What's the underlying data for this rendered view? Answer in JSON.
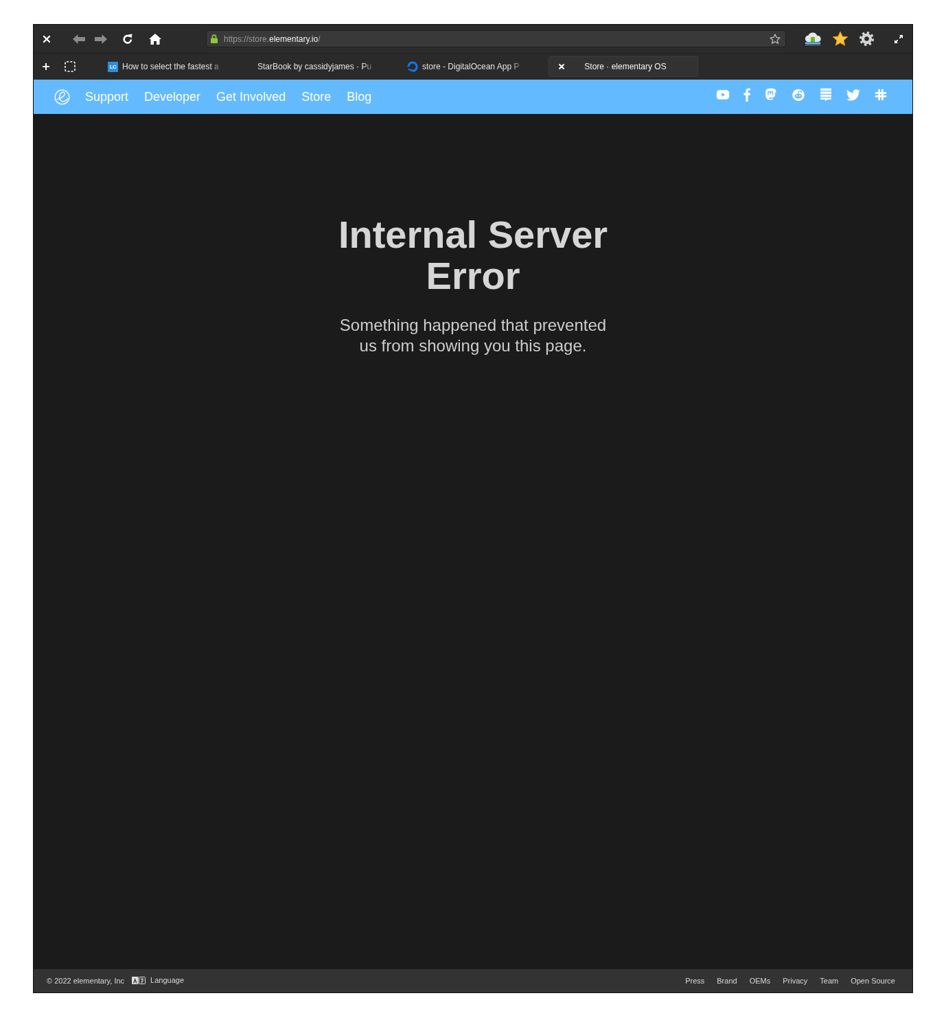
{
  "toolbar": {
    "navigation": [
      {
        "kind": "back",
        "disabled": true
      },
      {
        "kind": "forward",
        "disabled": true
      },
      {
        "kind": "reload",
        "disabled": false
      },
      {
        "kind": "home",
        "disabled": false
      }
    ],
    "address": {
      "host_prefix": "https://store.",
      "domain": "elementary.io",
      "path": "/"
    }
  },
  "tabs": [
    {
      "label": "How to select the fastest a",
      "kind": "badge",
      "badge": "LC",
      "selected": false
    },
    {
      "label": "StarBook by cassidyjames · Pu",
      "kind": "plain",
      "selected": false
    },
    {
      "label": "store - DigitalOcean App P",
      "kind": "ring",
      "selected": false
    },
    {
      "label": "Store · elementary OS",
      "kind": "plain",
      "selected": true
    }
  ],
  "nav": {
    "links": [
      "Support",
      "Developer",
      "Get Involved",
      "Store",
      "Blog"
    ]
  },
  "error": {
    "title": "Internal Server Error",
    "message": "Something happened that prevented us from showing you this page."
  },
  "footer": {
    "copyright": "© 2022 elementary, Inc",
    "language": "Language",
    "links": [
      "Press",
      "Brand",
      "OEMs",
      "Privacy",
      "Team",
      "Open Source"
    ]
  }
}
